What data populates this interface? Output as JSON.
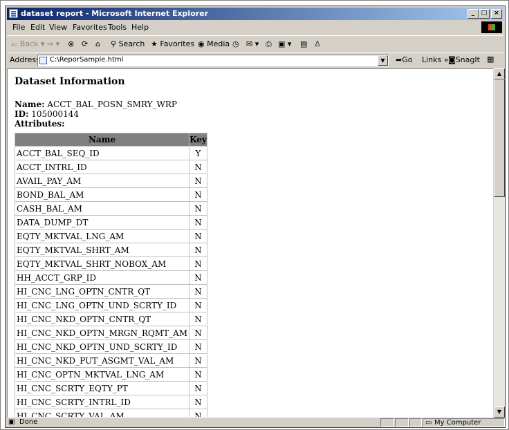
{
  "window": {
    "title": "dataset report - Microsoft Internet Explorer"
  },
  "menu": [
    "File",
    "Edit",
    "View",
    "Favorites",
    "Tools",
    "Help"
  ],
  "toolbar": {
    "back": "Back",
    "search": "Search",
    "favorites": "Favorites",
    "media": "Media"
  },
  "address": {
    "label": "Address",
    "url": "C:\\ReporSample.html",
    "go": "Go",
    "links": "Links",
    "snagit": "SnagIt"
  },
  "report": {
    "heading": "Dataset Information",
    "name_label": "Name:",
    "name_value": "ACCT_BAL_POSN_SMRY_WRP",
    "id_label": "ID:",
    "id_value": "105000144",
    "attributes_label": "Attributes:",
    "columns": [
      "Name",
      "Key"
    ],
    "rows": [
      {
        "name": "ACCT_BAL_SEQ_ID",
        "key": "Y"
      },
      {
        "name": "ACCT_INTRL_ID",
        "key": "N"
      },
      {
        "name": "AVAIL_PAY_AM",
        "key": "N"
      },
      {
        "name": "BOND_BAL_AM",
        "key": "N"
      },
      {
        "name": "CASH_BAL_AM",
        "key": "N"
      },
      {
        "name": "DATA_DUMP_DT",
        "key": "N"
      },
      {
        "name": "EQTY_MKTVAL_LNG_AM",
        "key": "N"
      },
      {
        "name": "EQTY_MKTVAL_SHRT_AM",
        "key": "N"
      },
      {
        "name": "EQTY_MKTVAL_SHRT_NOBOX_AM",
        "key": "N"
      },
      {
        "name": "HH_ACCT_GRP_ID",
        "key": "N"
      },
      {
        "name": "HI_CNC_LNG_OPTN_CNTR_QT",
        "key": "N"
      },
      {
        "name": "HI_CNC_LNG_OPTN_UND_SCRTY_ID",
        "key": "N"
      },
      {
        "name": "HI_CNC_NKD_OPTN_CNTR_QT",
        "key": "N"
      },
      {
        "name": "HI_CNC_NKD_OPTN_MRGN_RQMT_AM",
        "key": "N"
      },
      {
        "name": "HI_CNC_NKD_OPTN_UND_SCRTY_ID",
        "key": "N"
      },
      {
        "name": "HI_CNC_NKD_PUT_ASGMT_VAL_AM",
        "key": "N"
      },
      {
        "name": "HI_CNC_OPTN_MKTVAL_LNG_AM",
        "key": "N"
      },
      {
        "name": "HI_CNC_SCRTY_EQTY_PT",
        "key": "N"
      },
      {
        "name": "HI_CNC_SCRTY_INTRL_ID",
        "key": "N"
      },
      {
        "name": "HI_CNC_SCRTY_VAL_AM",
        "key": "N"
      }
    ]
  },
  "status": {
    "text": "Done",
    "zone": "My Computer"
  }
}
